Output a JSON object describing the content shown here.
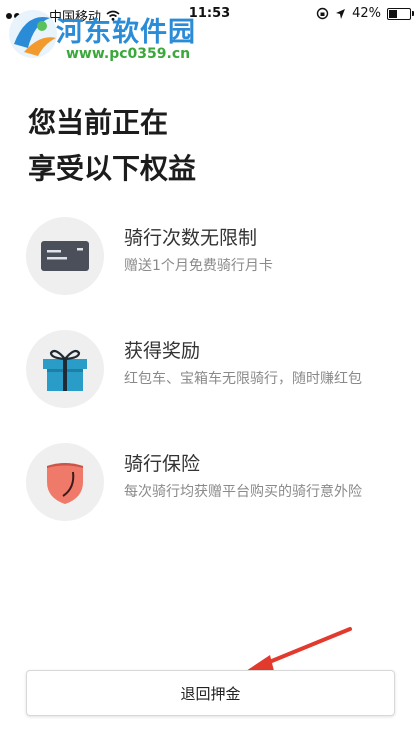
{
  "status_bar": {
    "carrier": "中国移动",
    "time": "11:53",
    "battery": "42%"
  },
  "watermark": {
    "title": "河东软件园",
    "url": "www.pc0359.cn"
  },
  "headline": {
    "line1": "您当前正在",
    "line2": "享受以下权益"
  },
  "benefits": [
    {
      "icon": "card-icon",
      "title": "骑行次数无限制",
      "desc": "赠送1个月免费骑行月卡"
    },
    {
      "icon": "gift-icon",
      "title": "获得奖励",
      "desc": "红包车、宝箱车无限骑行，随时赚红包"
    },
    {
      "icon": "shield-icon",
      "title": "骑行保险",
      "desc": "每次骑行均获赠平台购买的骑行意外险"
    }
  ],
  "refund_button": {
    "label": "退回押金"
  },
  "colors": {
    "card": "#4a4f59",
    "gift": "#2a9cc8",
    "shield": "#f07a6a",
    "arrow": "#e23b2e",
    "watermark_blue": "#2a8bd6",
    "watermark_green": "#3aa83a"
  }
}
